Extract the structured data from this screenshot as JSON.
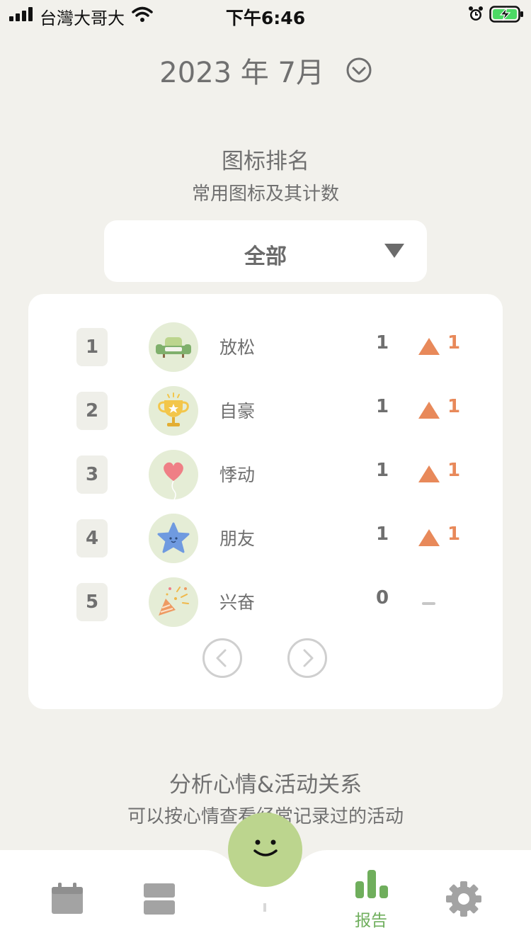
{
  "status_bar": {
    "carrier": "台灣大哥大",
    "time": "下午6:46"
  },
  "header": {
    "month": "2023 年 7月",
    "toggle_icon": "chevron-down-circle-icon"
  },
  "icon_ranking": {
    "title": "图标排名",
    "subtitle": "常用图标及其计数",
    "filter": {
      "selected": "全部"
    },
    "rows": [
      {
        "rank": "1",
        "icon": "sofa-icon",
        "name": "放松",
        "count": "1",
        "trend": "up",
        "change": "1"
      },
      {
        "rank": "2",
        "icon": "trophy-icon",
        "name": "自豪",
        "count": "1",
        "trend": "up",
        "change": "1"
      },
      {
        "rank": "3",
        "icon": "heart-balloon-icon",
        "name": "悸动",
        "count": "1",
        "trend": "up",
        "change": "1"
      },
      {
        "rank": "4",
        "icon": "star-face-icon",
        "name": "朋友",
        "count": "1",
        "trend": "up",
        "change": "1"
      },
      {
        "rank": "5",
        "icon": "party-popper-icon",
        "name": "兴奋",
        "count": "0",
        "trend": "none",
        "change": ""
      }
    ]
  },
  "mood_activity": {
    "title": "分析心情&活动关系",
    "subtitle": "可以按心情查看经常记录过的活动"
  },
  "tab_bar": {
    "tabs": [
      {
        "id": "calendar",
        "icon": "calendar-icon",
        "label": ""
      },
      {
        "id": "list",
        "icon": "list-icon",
        "label": ""
      },
      {
        "id": "report",
        "icon": "bar-chart-icon",
        "label": "报告",
        "active": true
      },
      {
        "id": "settings",
        "icon": "gear-icon",
        "label": ""
      }
    ],
    "center_button_icon": "smiley-face-icon"
  },
  "colors": {
    "background": "#f2f1ec",
    "accent_green": "#6fae5c",
    "trend_up": "#e8895a",
    "mood_green": "#bcd58e"
  }
}
